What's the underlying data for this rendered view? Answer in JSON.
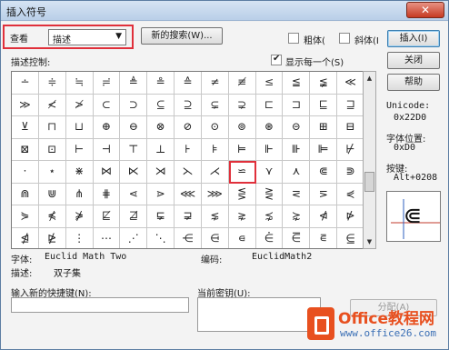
{
  "window": {
    "title": "插入符号",
    "close_glyph": "✕"
  },
  "toolbar": {
    "view_label": "查看",
    "view_value": "描述",
    "search_button": "新的搜索(W)...",
    "bold_label": "粗体(",
    "italic_label": "斜体(I",
    "bold_checked": false,
    "italic_checked": false,
    "insert_button": "插入(I)"
  },
  "side_buttons": {
    "close": "关闭",
    "help": "帮助"
  },
  "grid_header": {
    "control_label": "描述控制:",
    "show_each_label": "显示每一个(S)",
    "show_each_checked": true
  },
  "symbols": [
    [
      "∸",
      "≑",
      "≒",
      "≓",
      "≜",
      "≗",
      "≙",
      "≠",
      "≢",
      "≤",
      "≦",
      "≨",
      "≪"
    ],
    [
      "≫",
      "≮",
      "≯",
      "⊂",
      "⊃",
      "⊆",
      "⊇",
      "⊊",
      "⊋",
      "⊏",
      "⊐",
      "⊑",
      "⊒"
    ],
    [
      "⊻",
      "⊓",
      "⊔",
      "⊕",
      "⊖",
      "⊗",
      "⊘",
      "⊙",
      "⊚",
      "⊛",
      "⊝",
      "⊞",
      "⊟"
    ],
    [
      "⊠",
      "⊡",
      "⊢",
      "⊣",
      "⊤",
      "⊥",
      "⊦",
      "⊧",
      "⊨",
      "⊩",
      "⊪",
      "⊫",
      "⊬"
    ],
    [
      "⋅",
      "⋆",
      "⋇",
      "⋈",
      "⋉",
      "⋊",
      "⋋",
      "⋌",
      "⋍",
      "⋎",
      "⋏",
      "⋐",
      "⋑"
    ],
    [
      "⋒",
      "⋓",
      "⋔",
      "⋕",
      "⋖",
      "⋗",
      "⋘",
      "⋙",
      "⋚",
      "⋛",
      "⋜",
      "⋝",
      "⋞"
    ],
    [
      "⋟",
      "⋠",
      "⋡",
      "⋢",
      "⋣",
      "⋤",
      "⋥",
      "⋦",
      "⋧",
      "⋨",
      "⋩",
      "⋪",
      "⋫"
    ],
    [
      "⋬",
      "⋭",
      "⋮",
      "⋯",
      "⋰",
      "⋱",
      "⋲",
      "⋳",
      "⋴",
      "⋵",
      "⋶",
      "⋷",
      "⋸"
    ]
  ],
  "selected": {
    "row": 4,
    "col": 8
  },
  "details": {
    "unicode_label": "Unicode:",
    "unicode_value": "0x22D0",
    "font_pos_label": "字体位置:",
    "font_pos_value": "0xD0",
    "key_label": "按键:",
    "key_value": "Alt+0208",
    "preview_glyph": "⋐"
  },
  "font_info": {
    "font_label": "字体:",
    "font_value": "Euclid Math Two",
    "encoding_label": "编码:",
    "encoding_value": "EuclidMath2",
    "desc_label": "描述:",
    "desc_value": "双子集"
  },
  "shortcut": {
    "new_key_label": "输入新的快捷键(N):",
    "current_key_label": "当前密钥(U):",
    "assign_button": "分配(A)"
  },
  "watermark": {
    "brand": "Office教程网",
    "url": "www.office26.com"
  }
}
